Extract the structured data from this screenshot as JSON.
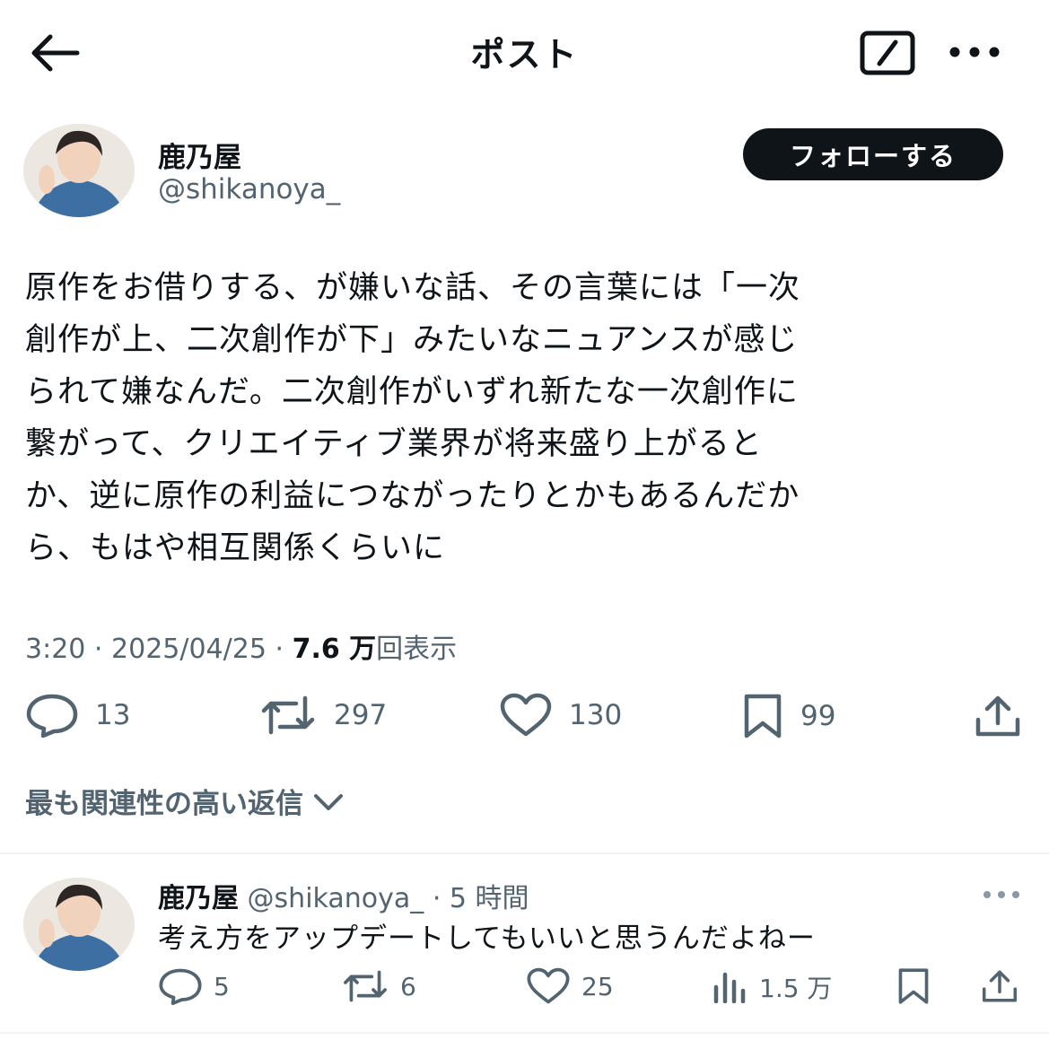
{
  "header": {
    "title": "ポスト",
    "back_icon": "arrow-left-icon",
    "edit_icon": "edit-square-icon",
    "more_icon": "more-horizontal-icon"
  },
  "post": {
    "author_name": "鹿乃屋",
    "author_handle": "@shikanoya_",
    "follow_label": "フォローする",
    "text": "原作をお借りする、が嫌いな話、その言葉には「一次\n創作が上、二次創作が下」みたいなニュアンスが感じ\nられて嫌なんだ。二次創作がいずれ新たな一次創作に\n繋がって、クリエイティブ業界が将来盛り上がると\nか、逆に原作の利益につながったりとかもあるんだか\nら、もはや相互関係くらいに",
    "time": "3:20",
    "date": "2025/04/25",
    "separator": "·",
    "views_count": "7.6 万",
    "views_label": "回表示",
    "actions": {
      "replies": "13",
      "reposts": "297",
      "likes": "130",
      "bookmarks": "99"
    }
  },
  "replies_sort": {
    "label": "最も関連性の高い返信"
  },
  "reply": {
    "author_name": "鹿乃屋",
    "author_handle": "@shikanoya_",
    "separator": "·",
    "time_ago": "5 時間",
    "text": "考え方をアップデートしてもいいと思うんだよねー",
    "actions": {
      "replies": "5",
      "reposts": "6",
      "likes": "25",
      "views": "1.5 万"
    }
  },
  "colors": {
    "text": "#0f1419",
    "secondary": "#536471",
    "follow_bg": "#0f1419",
    "avatar_sweater": "#3d6fa3"
  }
}
